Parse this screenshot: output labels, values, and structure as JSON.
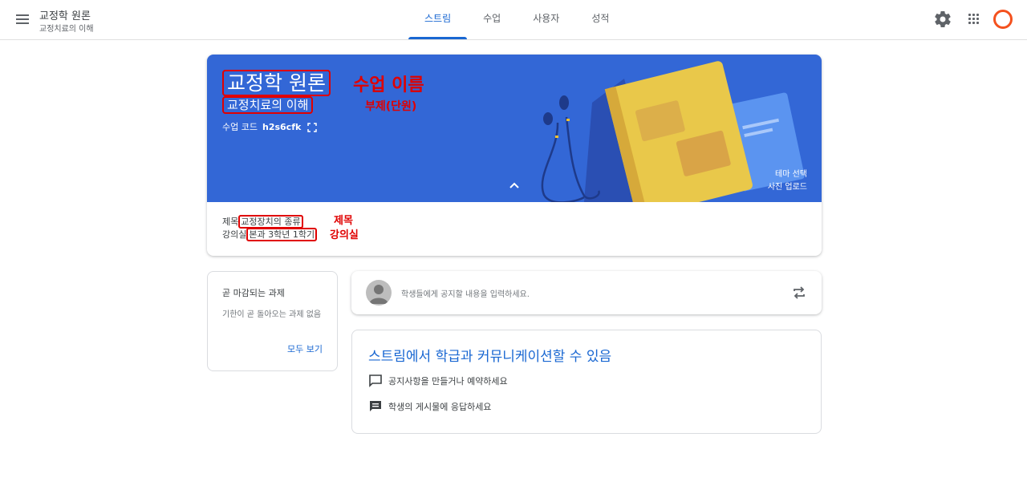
{
  "header": {
    "course_title": "교정학 원론",
    "course_subtitle": "교정치료의 이해",
    "tabs": [
      {
        "label": "스트림",
        "active": true
      },
      {
        "label": "수업",
        "active": false
      },
      {
        "label": "사용자",
        "active": false
      },
      {
        "label": "성적",
        "active": false
      }
    ],
    "icons": [
      "menu-icon",
      "gear-icon",
      "apps-icon",
      "avatar"
    ]
  },
  "banner": {
    "title": "교정학 원론",
    "subtitle": "교정치료의 이해",
    "code_label": "수업 코드",
    "code_value": "h2s6cfk",
    "theme_link": "테마 선택",
    "upload_link": "사진 업로드",
    "background_color": "#3367d6"
  },
  "details": {
    "subject_label": "제목",
    "subject_value": "교정장치의 종류",
    "room_label": "강의실",
    "room_value": "본과 3학년 1학기"
  },
  "annotations": {
    "class_name": "수업 이름",
    "subtitle_unit": "부제(단원)",
    "subject": "제목",
    "room": "강의실",
    "color": "#e00000"
  },
  "upcoming": {
    "title": "곧 마감되는 과제",
    "empty_message": "기한이 곧 돌아오는 과제 없음",
    "view_all": "모두 보기"
  },
  "announce": {
    "placeholder": "학생들에게 공지할 내용을 입력하세요."
  },
  "stream_info": {
    "title": "스트림에서 학급과 커뮤니케이션할 수 있음",
    "items": [
      {
        "icon": "announcement-icon",
        "text": "공지사항을 만들거나 예약하세요"
      },
      {
        "icon": "comment-icon",
        "text": "학생의 게시물에 응답하세요"
      }
    ]
  },
  "colors": {
    "accent": "#1967d2",
    "avatar_ring": "#f4511e"
  }
}
